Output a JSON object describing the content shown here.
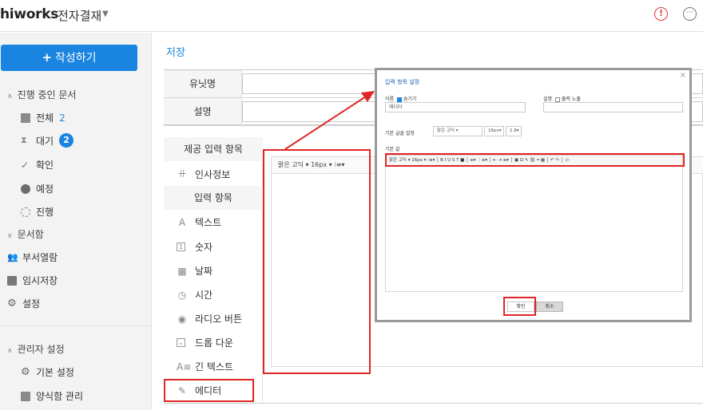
{
  "header": {
    "brand": "hiworks",
    "app_title": "전자결재",
    "caret_icon": "chevron-down-icon",
    "alert_glyph": "!",
    "more_glyph": "···"
  },
  "sidebar": {
    "compose_label": "작성하기",
    "group_in_progress": "진행 중인 문서",
    "items_in_progress": [
      {
        "label": "전체",
        "count": "2",
        "icon": "document-icon"
      },
      {
        "label": "대기",
        "badge": "2",
        "icon": "hourglass-icon"
      },
      {
        "label": "확인",
        "icon": "check-icon"
      },
      {
        "label": "예정",
        "icon": "clock-icon"
      },
      {
        "label": "진행",
        "icon": "spinner-icon"
      }
    ],
    "group_docbox": "문서함",
    "items_docbox": [
      {
        "label": "부서열람",
        "icon": "people-icon"
      },
      {
        "label": "임시저장",
        "icon": "archive-icon"
      },
      {
        "label": "설정",
        "icon": "gear-icon"
      }
    ],
    "group_admin": "관리자 설정",
    "items_admin": [
      {
        "label": "기본 설정",
        "icon": "gear-icon"
      },
      {
        "label": "양식함 관리",
        "icon": "document-icon"
      }
    ]
  },
  "main": {
    "save_label": "저장",
    "unit_name_label": "유닛명",
    "description_label": "설명",
    "unit_name_value": "",
    "description_value": "",
    "palette": {
      "provided_header": "제공 입력 항목",
      "hr_info": "인사정보",
      "input_header": "입력 항목",
      "items": [
        {
          "label": "텍스트",
          "glyph": "A"
        },
        {
          "label": "숫자",
          "glyph": "1"
        },
        {
          "label": "날짜",
          "glyph": "▦"
        },
        {
          "label": "시간",
          "glyph": "◷"
        },
        {
          "label": "라디오 버튼",
          "glyph": "◉"
        },
        {
          "label": "드롭 다운",
          "glyph": "⌄"
        },
        {
          "label": "긴 텍스트",
          "glyph": "A≡"
        },
        {
          "label": "에디터",
          "glyph": "✎"
        }
      ]
    },
    "canvas_toolbar": "맑은 고딕 ▾      16px        ▾   ⁝≡▾"
  },
  "modal": {
    "title": "입력 항목 설정",
    "close_glyph": "×",
    "name_label": "이름",
    "required_label": "숨기기",
    "name_value": "에디터",
    "desc_label": "설명",
    "include_label": "출력 노출",
    "desc_value": "",
    "font_setting_label": "기본 글꼴 설정",
    "font_family": "맑은 고딕",
    "font_size": "16px",
    "line_height": "1.8",
    "default_value_label": "기본 값",
    "editor_toolbar": "맑은 고딕 ▾   16px  ▾  ⁝≡▾ │ B  I  U  S  T  ■ │ ≡▾  ⋮≡▾ │ ⇤  ⇥  ≡▾ │ ▣  Ω  ✎  ⛓  ━  ▦ │ ↶  ↷ │ ‹/›",
    "ok_label": "확인",
    "cancel_label": "취소"
  },
  "colors": {
    "accent": "#1a85e0",
    "highlight": "#e02525"
  }
}
